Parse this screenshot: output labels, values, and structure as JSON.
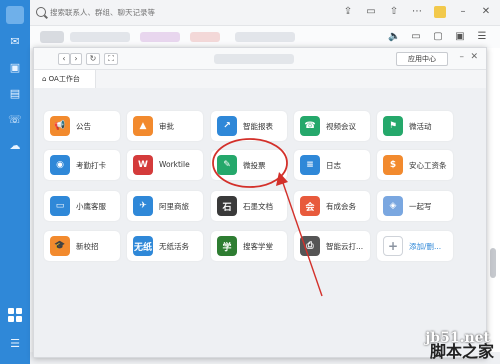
{
  "search": {
    "placeholder": "搜索联系人、群组、聊天记录等"
  },
  "oa": {
    "app_center_label": "应用中心",
    "tab_label": "OA工作台"
  },
  "apps": [
    {
      "label": "公告",
      "color": "#f28a2e",
      "glyph": "📢",
      "icon": "megaphone-icon"
    },
    {
      "label": "审批",
      "color": "#f28a2e",
      "glyph": "▲",
      "icon": "stamp-icon"
    },
    {
      "label": "智能报表",
      "color": "#2f88d8",
      "glyph": "↗",
      "icon": "chart-icon"
    },
    {
      "label": "视频会议",
      "color": "#25a86b",
      "glyph": "☎",
      "icon": "video-call-icon"
    },
    {
      "label": "微活动",
      "color": "#25a86b",
      "glyph": "⚑",
      "icon": "activity-icon"
    },
    {
      "label": "考勤打卡",
      "color": "#2f88d8",
      "glyph": "◉",
      "icon": "location-icon"
    },
    {
      "label": "Worktile",
      "color": "#d43b3b",
      "glyph": "W",
      "icon": "worktile-icon"
    },
    {
      "label": "微投票",
      "color": "#25a86b",
      "glyph": "✎",
      "icon": "vote-icon"
    },
    {
      "label": "日志",
      "color": "#2f88d8",
      "glyph": "≡",
      "icon": "log-icon"
    },
    {
      "label": "安心工资条",
      "color": "#f28a2e",
      "glyph": "$",
      "icon": "salary-icon"
    },
    {
      "label": "小鹰客服",
      "color": "#2f88d8",
      "glyph": "▭",
      "icon": "service-icon"
    },
    {
      "label": "阿里商旅",
      "color": "#2f88d8",
      "glyph": "✈",
      "icon": "travel-icon"
    },
    {
      "label": "石墨文档",
      "color": "#3a3a3a",
      "glyph": "石",
      "icon": "shimo-icon"
    },
    {
      "label": "有成会务",
      "color": "#e85a3c",
      "glyph": "会",
      "icon": "meeting-icon"
    },
    {
      "label": "一起写",
      "color": "#7aa7e0",
      "glyph": "◈",
      "icon": "write-icon"
    },
    {
      "label": "新校招",
      "color": "#f28a2e",
      "glyph": "🎓",
      "icon": "recruit-icon"
    },
    {
      "label": "无纸活务",
      "color": "#2f88d8",
      "glyph": "无纸",
      "icon": "paperless-icon"
    },
    {
      "label": "搜客学堂",
      "color": "#2e7d32",
      "glyph": "学",
      "icon": "school-icon"
    },
    {
      "label": "智能云打...",
      "color": "#555555",
      "glyph": "⎙",
      "icon": "printer-icon"
    },
    {
      "label": "添加/删...",
      "color": "#ffffff",
      "glyph": "+",
      "icon": "add-icon"
    }
  ],
  "watermark": {
    "line1": "jb51.net",
    "line2": "脚本之家"
  }
}
